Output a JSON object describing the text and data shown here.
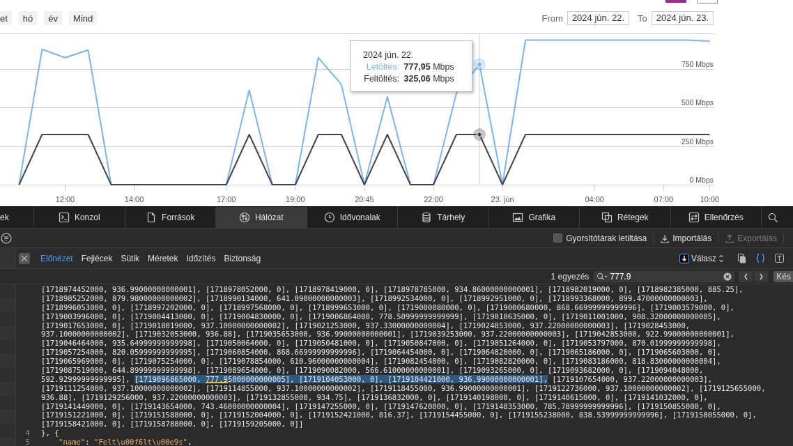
{
  "range_buttons": [
    {
      "label": "et"
    },
    {
      "label": "hó"
    },
    {
      "label": "év"
    },
    {
      "label": "Mind"
    }
  ],
  "date_range": {
    "from_label": "From",
    "from": "2024 jún. 22.",
    "to_label": "To",
    "to": "2024 jún. 23."
  },
  "chart": {
    "chart_data": {
      "type": "line",
      "categories": [
        null,
        null,
        "12:00",
        null,
        null,
        "14:00",
        null,
        null,
        null,
        "17:00",
        null,
        null,
        "19:00",
        null,
        null,
        "20:45",
        null,
        null,
        "22:00",
        null,
        null,
        "23. jún",
        null,
        null,
        null,
        "04:00",
        null,
        null,
        "07:00",
        null,
        "10:00"
      ],
      "series": [
        {
          "color": "#7cb5ec",
          "values": [
            0,
            877,
            823,
            873,
            0,
            0,
            0,
            0,
            0,
            0,
            613,
            0,
            0,
            823,
            650,
            0,
            570,
            0,
            0,
            593,
            778,
            0,
            937,
            937,
            937,
            937,
            937,
            937,
            937,
            937,
            930
          ]
        },
        {
          "color": "#434348",
          "values": [
            0,
            325,
            325,
            325,
            0,
            0,
            0,
            0,
            0,
            0,
            325,
            0,
            0,
            325,
            325,
            0,
            325,
            0,
            0,
            325,
            325,
            0,
            325,
            325,
            325,
            325,
            325,
            325,
            325,
            325,
            325
          ]
        }
      ],
      "ylim": [
        0,
        980
      ],
      "yticks": [
        {
          "value": 0,
          "label": "0 Mbps"
        },
        {
          "value": 250,
          "label": "250 Mbps"
        },
        {
          "value": 500,
          "label": "500 Mbps"
        },
        {
          "value": 750,
          "label": "750 Mbps"
        }
      ],
      "grid": true
    },
    "tooltip": {
      "date": "2024 jún. 22.",
      "rows": [
        {
          "label": "Letöltés:",
          "value": "777,95",
          "unit": "Mbps"
        },
        {
          "label": "Feltöltés:",
          "value": "325,06",
          "unit": "Mbps"
        }
      ]
    }
  },
  "devtools": {
    "main_tabs": [
      {
        "label": "ek",
        "selected": false
      },
      {
        "label": "Konzol",
        "selected": false
      },
      {
        "label": "Források",
        "selected": false
      },
      {
        "label": "Hálózat",
        "selected": true
      },
      {
        "label": "Idővonalak",
        "selected": false
      },
      {
        "label": "Tárhely",
        "selected": false
      },
      {
        "label": "Grafika",
        "selected": false
      },
      {
        "label": "Rétegek",
        "selected": false
      },
      {
        "label": "Ellenőrzés",
        "selected": false
      }
    ],
    "toolbar": {
      "disable_caches": {
        "label": "Gyorsítótárak letiltása",
        "checked": false
      },
      "import": {
        "label": "Importálás",
        "disabled": false
      },
      "export": {
        "label": "Exportálás",
        "disabled": true
      }
    },
    "detail_tabs": [
      {
        "label": "Előnézet",
        "selected": true
      },
      {
        "label": "Fejlécek",
        "selected": false
      },
      {
        "label": "Sütik",
        "selected": false
      },
      {
        "label": "Méretek",
        "selected": false
      },
      {
        "label": "Időzítés",
        "selected": false
      },
      {
        "label": "Biztonság",
        "selected": false
      }
    ],
    "response_menu": {
      "label": "Válasz"
    },
    "view_buttons": [
      {
        "selected": false
      },
      {
        "selected": true
      },
      {
        "selected": false
      }
    ],
    "search": {
      "match_count": "1 egyezés",
      "value": "777.9",
      "partial_button": "Kés"
    },
    "code_lines": [
      {
        "segments": [
          {
            "kind": "text",
            "text": "[1718974452000, 936.99000000000001], [1718978052000, 0], [1718978419000, 0], [1718978785000, 934.86000000000001], [1718982019000, 0], [1718982385000, 885.25],"
          }
        ]
      },
      {
        "segments": [
          {
            "kind": "text",
            "text": "[1718985252000, 879.98000000000002], [1718990134000, 641.09000000000003], [1718992534000, 0], [1718992951000, 0], [1718993368000, 899.47000000000003],"
          }
        ]
      },
      {
        "segments": [
          {
            "kind": "text",
            "text": "[1718996053000, 0], [1718997202000, 0], [1718997568000, 0], [1718999653000, 0], [1719000080000, 0], [1719000680000, 868.66999999999996], [1719003579000, 0],"
          }
        ]
      },
      {
        "segments": [
          {
            "kind": "text",
            "text": "[1719003996000, 0], [1719004413000, 0], [1719004830000, 0], [1719006864000, 778.50999999999999], [1719010635000, 0], [1719011001000, 908.32000000000005],"
          }
        ]
      },
      {
        "segments": [
          {
            "kind": "text",
            "text": "[1719017653000, 0], [1719018019000, 937.10000000000002], [1719021253000, 937.33000000000004], [1719024853000, 937.22000000000003], [1719028453000,"
          }
        ]
      },
      {
        "segments": [
          {
            "kind": "text",
            "text": "937.10000000000002], [1719032053000, 936.88], [1719035653000, 936.99000000000001], [1719039253000, 937.22000000000003], [1719042853000, 922.99000000000001],"
          }
        ]
      },
      {
        "segments": [
          {
            "kind": "text",
            "text": "[1719046464000, 935.64999999999998], [1719050064000, 0], [1719050481000, 0], [1719050847000, 0], [1719051264000, 0], [1719053797000, 870.01999999999998],"
          }
        ]
      },
      {
        "segments": [
          {
            "kind": "text",
            "text": "[1719057254000, 820.05999999999995], [1719060854000, 868.66999999999996], [1719064454000, 0], [1719064820000, 0], [1719065186000, 0], [1719065603000, 0],"
          }
        ]
      },
      {
        "segments": [
          {
            "kind": "text",
            "text": "[1719065969000, 0], [1719075254000, 0], [1719078854000, 610.96000000000004], [1719082454000, 0], [1719082820000, 0], [1719083186000, 818.83000000000004],"
          }
        ]
      },
      {
        "segments": [
          {
            "kind": "text",
            "text": "[1719087519000, 644.89999999999998], [1719089654000, 0], [1719090082000, 566.61000000000001], [1719093265000, 0], [1719093682000, 0], [1719094048000,"
          }
        ]
      },
      {
        "segments": [
          {
            "kind": "text",
            "text": "592.92999999999995], "
          },
          {
            "kind": "highlight",
            "text": "[1719096865000, "
          },
          {
            "kind": "current",
            "text": "777.9"
          },
          {
            "kind": "highlight",
            "text": "5000000000005], [1719104053000, 0], [1719104421000, 936.99000000000001],"
          },
          {
            "kind": "text",
            "text": " [1719107654000, 937.22000000000003],"
          }
        ]
      },
      {
        "segments": [
          {
            "kind": "text",
            "text": "[1719111254000, 937.10000000000002], [1719114855000, 937.10000000000002], [1719118455000, 936.99000000000001], [1719122736000, 937.10000000000002], [1719125655000,"
          }
        ]
      },
      {
        "segments": [
          {
            "kind": "text",
            "text": "936.88], [1719129256000, 937.22000000000003], [1719132855000, 934.75], [1719136832000, 0], [1719140198000, 0], [1719140615000, 0], [1719141032000, 0],"
          }
        ]
      },
      {
        "segments": [
          {
            "kind": "text",
            "text": "[1719141449000, 0], [1719143654000, 743.46000000000004], [1719147255000, 0], [1719147620000, 0], [1719148353000, 785.78999999999996], [1719150855000, 0],"
          }
        ]
      },
      {
        "segments": [
          {
            "kind": "text",
            "text": "[1719151221000, 0], [1719151588000, 0], [1719152004000, 0], [1719152421000, 816.37], [1719154455000, 0], [1719155238000, 838.53999999999996], [1719158055000, 0],"
          }
        ]
      },
      {
        "segments": [
          {
            "kind": "text",
            "text": "[1719158421000, 0], [1719158788000, 0], [1719159205000, 0]]"
          }
        ]
      },
      {
        "number": "4",
        "segments": [
          {
            "kind": "text",
            "text": "}, {"
          }
        ]
      },
      {
        "number": "5",
        "indented": true,
        "segments": [
          {
            "kind": "key",
            "text": "\"name\""
          },
          {
            "kind": "text",
            "text": ": "
          },
          {
            "kind": "string",
            "text": "\"Felt\\u00f6lt\\u00e9s\""
          },
          {
            "kind": "text",
            "text": ","
          }
        ]
      }
    ]
  }
}
